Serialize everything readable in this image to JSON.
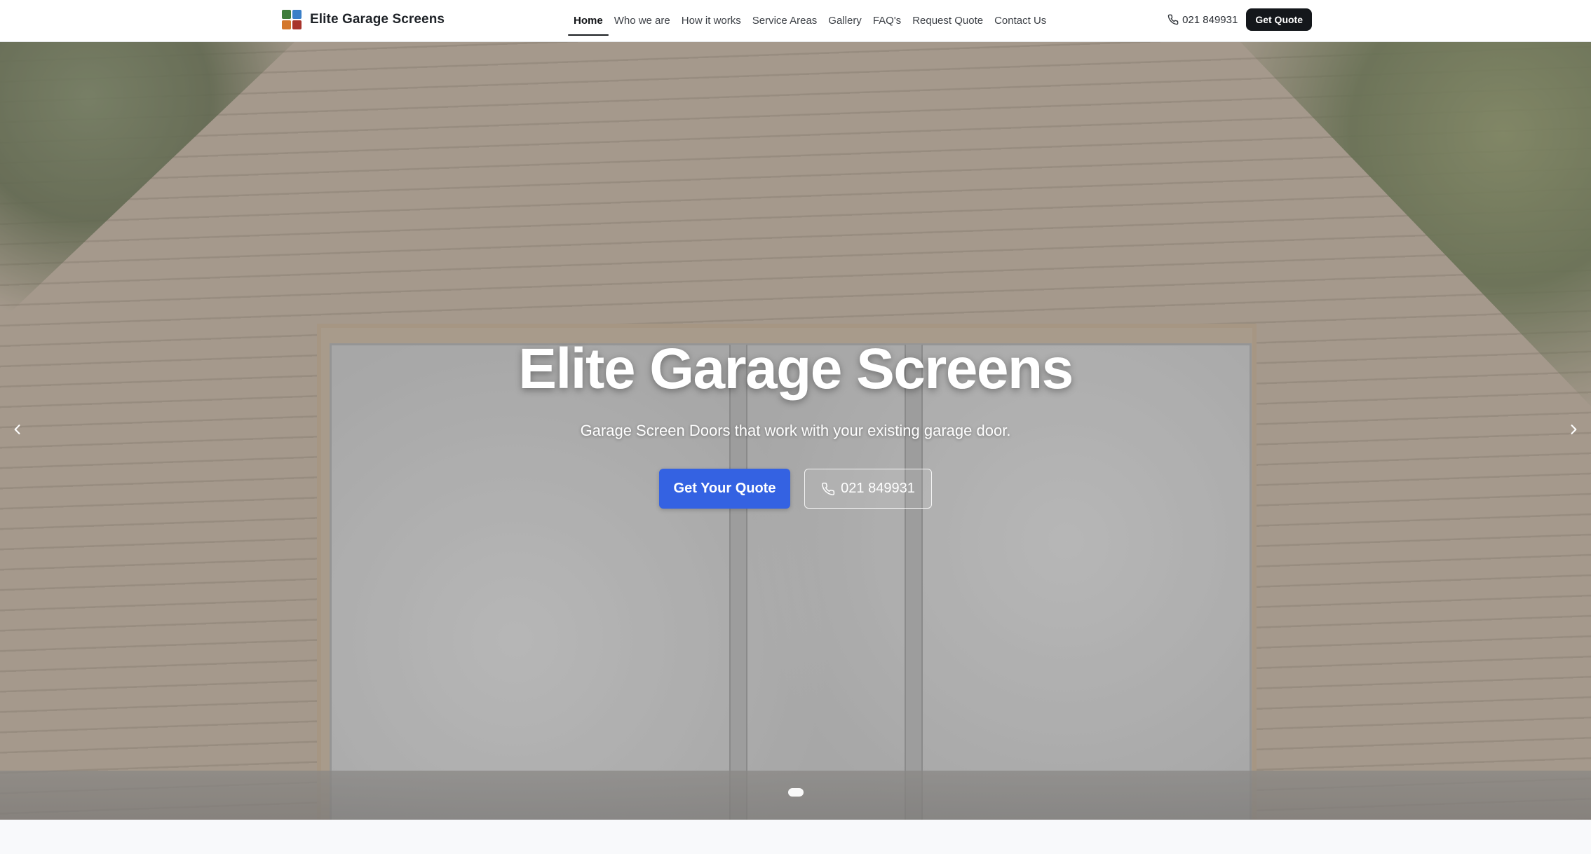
{
  "nav": {
    "brand_name": "Elite Garage Screens",
    "logo_colors": [
      "#3f7d3c",
      "#3a7fc8",
      "#d4772b",
      "#a8342c"
    ],
    "links": [
      {
        "label": "Home",
        "active": true
      },
      {
        "label": "Who we are",
        "active": false
      },
      {
        "label": "How it works",
        "active": false
      },
      {
        "label": "Service Areas",
        "active": false
      },
      {
        "label": "Gallery",
        "active": false
      },
      {
        "label": "FAQ's",
        "active": false
      },
      {
        "label": "Request Quote",
        "active": false
      },
      {
        "label": "Contact Us",
        "active": false
      }
    ],
    "phone": "021 849931",
    "cta_label": "Get Quote",
    "icons": {
      "phone": "phone-icon"
    }
  },
  "hero": {
    "title": "Elite Garage Screens",
    "subtitle": "Garage Screen Doors that work with your existing garage door.",
    "primary_button": "Get Your Quote",
    "secondary_button_phone": "021 849931",
    "primary_color": "#3462e2",
    "icons": {
      "prev": "chevron-left-icon",
      "next": "chevron-right-icon",
      "phone": "phone-icon"
    },
    "carousel": {
      "slide_count": 1,
      "active_index": 0
    }
  },
  "colors": {
    "nav_bg": "#ffffff",
    "cta_bg": "#14171b",
    "page_bg": "#f8f9fb"
  }
}
